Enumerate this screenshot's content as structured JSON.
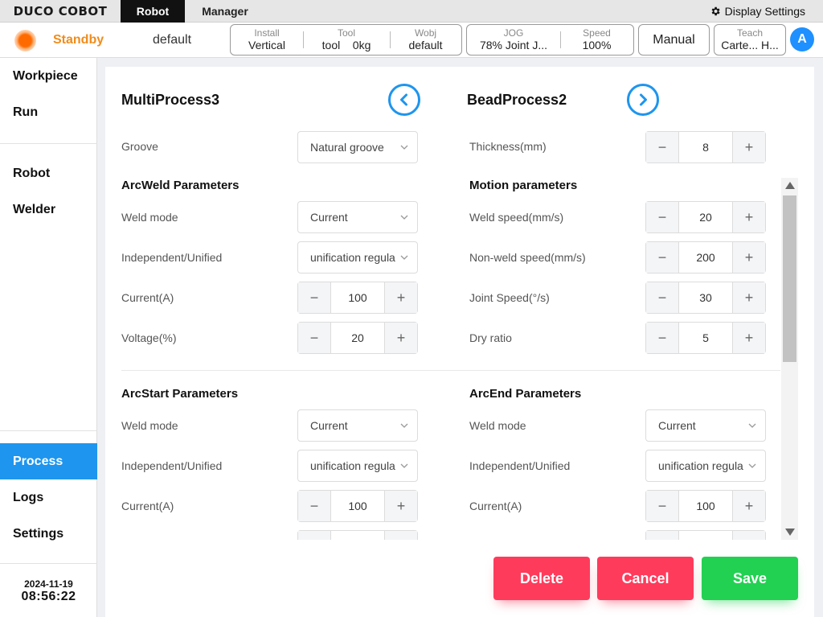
{
  "topbar": {
    "logo": "DUCO COBOT",
    "tabs": [
      "Robot",
      "Manager"
    ],
    "display_settings": "Display Settings"
  },
  "status": {
    "state": "Standby",
    "program": "default",
    "install": {
      "label": "Install",
      "value": "Vertical"
    },
    "tool": {
      "label": "Tool",
      "name": "tool",
      "load": "0kg"
    },
    "wobj": {
      "label": "Wobj",
      "value": "default"
    },
    "jog": {
      "label": "JOG",
      "value": "78%  Joint J..."
    },
    "speed": {
      "label": "Speed",
      "value": "100%"
    },
    "mode": "Manual",
    "teach": {
      "label": "Teach",
      "value": "Carte... H..."
    },
    "avatar": "A"
  },
  "sidebar": {
    "items": [
      "Workpiece",
      "Run",
      "Robot",
      "Welder",
      "Process",
      "Logs",
      "Settings"
    ],
    "active": "Process",
    "date": "2024-11-19",
    "time": "08:56:22"
  },
  "left": {
    "title": "MultiProcess3",
    "groove_label": "Groove",
    "groove_value": "Natural groove",
    "arcweld_title": "ArcWeld Parameters",
    "weld_mode_label": "Weld mode",
    "weld_mode_value": "Current",
    "indep_label": "Independent/Unified",
    "indep_value": "unification regula",
    "current_label": "Current(A)",
    "current_value": "100",
    "voltage_label": "Voltage(%)",
    "voltage_value": "20",
    "arcstart_title": "ArcStart Parameters",
    "as_weld_mode_label": "Weld mode",
    "as_weld_mode_value": "Current",
    "as_indep_label": "Independent/Unified",
    "as_indep_value": "unification regula",
    "as_current_label": "Current(A)",
    "as_current_value": "100"
  },
  "right": {
    "title": "BeadProcess2",
    "thickness_label": "Thickness(mm)",
    "thickness_value": "8",
    "motion_title": "Motion parameters",
    "weld_speed_label": "Weld speed(mm/s)",
    "weld_speed_value": "20",
    "nonweld_label": "Non-weld speed(mm/s)",
    "nonweld_value": "200",
    "joint_label": "Joint Speed(°/s)",
    "joint_value": "30",
    "dry_label": "Dry ratio",
    "dry_value": "5",
    "arcend_title": "ArcEnd Parameters",
    "ae_weld_mode_label": "Weld mode",
    "ae_weld_mode_value": "Current",
    "ae_indep_label": "Independent/Unified",
    "ae_indep_value": "unification regula",
    "ae_current_label": "Current(A)",
    "ae_current_value": "100"
  },
  "stepper": {
    "minus": "−",
    "plus": "+"
  },
  "actions": {
    "delete": "Delete",
    "cancel": "Cancel",
    "save": "Save"
  },
  "colors": {
    "accent": "#1e95ee",
    "danger": "#ff3b5c",
    "success": "#22d152",
    "standby": "#f08c1a"
  }
}
